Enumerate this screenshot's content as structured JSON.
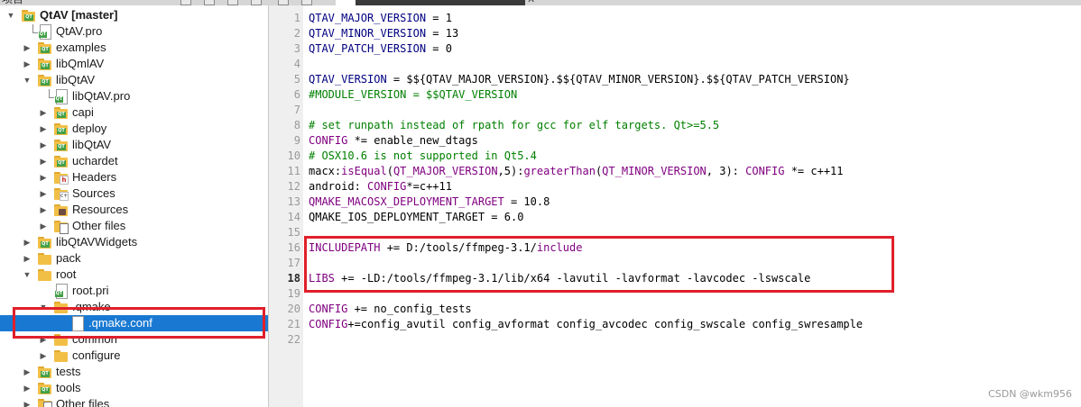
{
  "toolbar": {
    "partial_label": "项目"
  },
  "tree": [
    {
      "label": "QtAV [master]",
      "icon": "folder-qt-icon",
      "arrow": "down",
      "bold": true
    },
    {
      "label": "QtAV.pro",
      "icon": "qt-project-file-icon",
      "arrow": ""
    },
    {
      "label": "examples",
      "icon": "folder-qt-icon",
      "arrow": "right"
    },
    {
      "label": "libQmlAV",
      "icon": "folder-qt-icon",
      "arrow": "right"
    },
    {
      "label": "libQtAV",
      "icon": "folder-qt-icon",
      "arrow": "down"
    },
    {
      "label": "libQtAV.pro",
      "icon": "qt-project-file-icon",
      "arrow": ""
    },
    {
      "label": "capi",
      "icon": "folder-qt-icon",
      "arrow": "right"
    },
    {
      "label": "deploy",
      "icon": "folder-qt-icon",
      "arrow": "right"
    },
    {
      "label": "libQtAV",
      "icon": "folder-qt-icon",
      "arrow": "right"
    },
    {
      "label": "uchardet",
      "icon": "folder-qt-icon",
      "arrow": "right"
    },
    {
      "label": "Headers",
      "icon": "folder-headers-icon",
      "arrow": "right"
    },
    {
      "label": "Sources",
      "icon": "folder-sources-icon",
      "arrow": "right"
    },
    {
      "label": "Resources",
      "icon": "folder-resources-icon",
      "arrow": "right"
    },
    {
      "label": "Other files",
      "icon": "folder-other-files-icon",
      "arrow": "right"
    },
    {
      "label": "libQtAVWidgets",
      "icon": "folder-qt-icon",
      "arrow": "right"
    },
    {
      "label": "pack",
      "icon": "folder-icon",
      "arrow": "right"
    },
    {
      "label": "root",
      "icon": "folder-icon",
      "arrow": "down"
    },
    {
      "label": "root.pri",
      "icon": "pri-file-icon",
      "arrow": ""
    },
    {
      "label": ".qmake",
      "icon": "folder-icon",
      "arrow": "down"
    },
    {
      "label": ".qmake.conf",
      "icon": "file-icon",
      "arrow": "",
      "selected": true
    },
    {
      "label": "common",
      "icon": "folder-icon",
      "arrow": "right"
    },
    {
      "label": "configure",
      "icon": "folder-icon",
      "arrow": "right"
    },
    {
      "label": "tests",
      "icon": "folder-qt-icon",
      "arrow": "right"
    },
    {
      "label": "tools",
      "icon": "folder-qt-icon",
      "arrow": "right"
    },
    {
      "label": "Other files",
      "icon": "folder-other-files-icon",
      "arrow": "right"
    }
  ],
  "editor": {
    "current_line": 18,
    "lines": [
      [
        [
          "QTAV_MAJOR_VERSION",
          "id"
        ],
        [
          " = 1",
          "pl"
        ]
      ],
      [
        [
          "QTAV_MINOR_VERSION",
          "id"
        ],
        [
          " = 13",
          "pl"
        ]
      ],
      [
        [
          "QTAV_PATCH_VERSION",
          "id"
        ],
        [
          " = 0",
          "pl"
        ]
      ],
      [],
      [
        [
          "QTAV_VERSION",
          "id"
        ],
        [
          " = $${QTAV_MAJOR_VERSION}.$${QTAV_MINOR_VERSION}.$${QTAV_PATCH_VERSION}",
          "pl"
        ]
      ],
      [
        [
          "#MODULE_VERSION = $$QTAV_VERSION",
          "cm"
        ]
      ],
      [],
      [
        [
          "# set runpath instead of rpath for gcc for elf targets. Qt>=5.5",
          "cm"
        ]
      ],
      [
        [
          "CONFIG",
          "kw"
        ],
        [
          " *= enable_new_dtags",
          "pl"
        ]
      ],
      [
        [
          "# OSX10.6 is not supported in Qt5.4",
          "cm"
        ]
      ],
      [
        [
          "macx",
          "pl"
        ],
        [
          ":",
          "pl"
        ],
        [
          "isEqual",
          "fn"
        ],
        [
          "(",
          "pl"
        ],
        [
          "QT_MAJOR_VERSION",
          "vr"
        ],
        [
          ",5):",
          "pl"
        ],
        [
          "greaterThan",
          "fn"
        ],
        [
          "(",
          "pl"
        ],
        [
          "QT_MINOR_VERSION",
          "vr"
        ],
        [
          ", 3): ",
          "pl"
        ],
        [
          "CONFIG",
          "kw"
        ],
        [
          " *= c++11",
          "pl"
        ]
      ],
      [
        [
          "android: ",
          "pl"
        ],
        [
          "CONFIG",
          "kw"
        ],
        [
          "*=c++11",
          "pl"
        ]
      ],
      [
        [
          "QMAKE_MACOSX_DEPLOYMENT_TARGET",
          "kw"
        ],
        [
          " = 10.8",
          "pl"
        ]
      ],
      [
        [
          "QMAKE_IOS_DEPLOYMENT_TARGET",
          "pl"
        ],
        [
          " = 6.0",
          "pl"
        ]
      ],
      [],
      [
        [
          "INCLUDEPATH",
          "kw"
        ],
        [
          " += D:/tools/ffmpeg-3.1/",
          "pl"
        ],
        [
          "include",
          "fn"
        ]
      ],
      [],
      [
        [
          "LIBS",
          "kw"
        ],
        [
          " += -LD:/tools/ffmpeg-3.1/lib/x64 -lavutil -lavformat -lavcodec -lswscale",
          "pl"
        ]
      ],
      [],
      [
        [
          "CONFIG",
          "kw"
        ],
        [
          " += no_config_tests",
          "pl"
        ]
      ],
      [
        [
          "CONFIG",
          "kw"
        ],
        [
          "+=config_avutil config_avformat config_avcodec config_swscale config_swresample",
          "pl"
        ]
      ],
      []
    ]
  },
  "watermark": "CSDN @wkm956",
  "colors": {
    "selection": "#1979d2",
    "annotation_box": "#e0202a",
    "gutter": "#efefef"
  }
}
